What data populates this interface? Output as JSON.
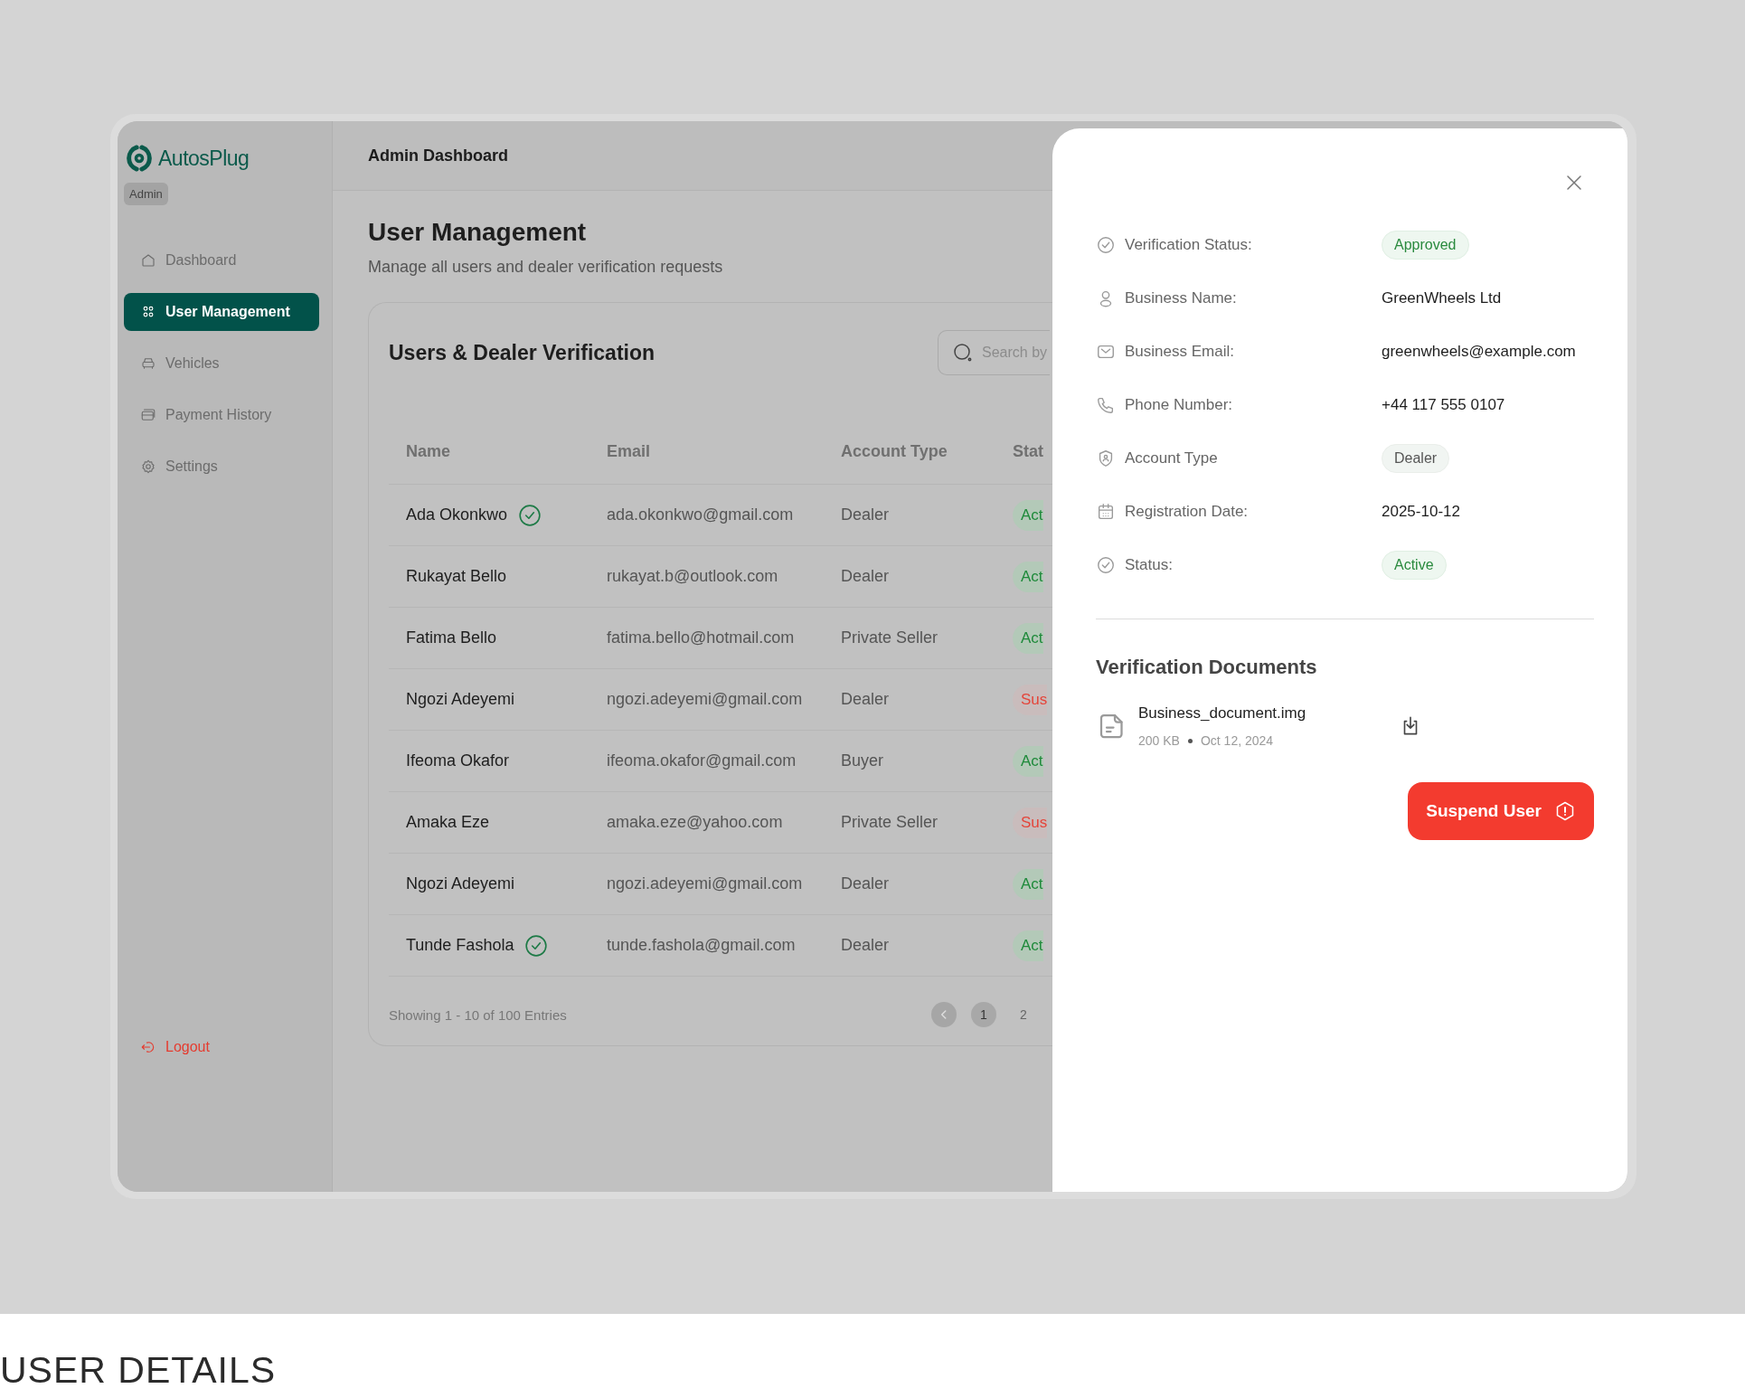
{
  "sidebar": {
    "logo": "AutosPlug",
    "role_badge": "Admin",
    "items": [
      {
        "label": "Dashboard",
        "selected": false
      },
      {
        "label": "User Management",
        "selected": true
      },
      {
        "label": "Vehicles",
        "selected": false
      },
      {
        "label": "Payment History",
        "selected": false
      },
      {
        "label": "Settings",
        "selected": false
      }
    ],
    "logout": "Logout"
  },
  "header": {
    "title": "Admin Dashboard"
  },
  "page": {
    "title": "User Management",
    "subtitle": "Manage all users and dealer verification requests"
  },
  "card": {
    "title": "Users & Dealer Verification",
    "search": {
      "placeholder": "Search by"
    },
    "columns": [
      "Name",
      "Email",
      "Account Type",
      "Stat"
    ],
    "rows": [
      {
        "name": "Ada Okonkwo",
        "verified": true,
        "email": "ada.okonkwo@gmail.com",
        "account_type": "Dealer",
        "status": "Act",
        "kind": "active"
      },
      {
        "name": "Rukayat Bello",
        "verified": false,
        "email": "rukayat.b@outlook.com",
        "account_type": "Dealer",
        "status": "Act",
        "kind": "active"
      },
      {
        "name": "Fatima Bello",
        "verified": false,
        "email": "fatima.bello@hotmail.com",
        "account_type": "Private Seller",
        "status": "Act",
        "kind": "active"
      },
      {
        "name": "Ngozi Adeyemi",
        "verified": false,
        "email": "ngozi.adeyemi@gmail.com",
        "account_type": "Dealer",
        "status": "Sus",
        "kind": "suspended"
      },
      {
        "name": "Ifeoma Okafor",
        "verified": false,
        "email": "ifeoma.okafor@gmail.com",
        "account_type": "Buyer",
        "status": "Act",
        "kind": "active"
      },
      {
        "name": "Amaka Eze",
        "verified": false,
        "email": "amaka.eze@yahoo.com",
        "account_type": "Private Seller",
        "status": "Sus",
        "kind": "suspended"
      },
      {
        "name": "Ngozi Adeyemi",
        "verified": false,
        "email": "ngozi.adeyemi@gmail.com",
        "account_type": "Dealer",
        "status": "Act",
        "kind": "active"
      },
      {
        "name": "Tunde Fashola",
        "verified": true,
        "email": "tunde.fashola@gmail.com",
        "account_type": "Dealer",
        "status": "Act",
        "kind": "active"
      }
    ],
    "footer": "Showing 1 - 10 of 100 Entries",
    "pages": [
      {
        "label": "1",
        "selected": true
      },
      {
        "label": "2",
        "selected": false
      }
    ]
  },
  "details": {
    "fields": [
      {
        "label": "Verification Status:",
        "value": "Approved",
        "kind": "success_badge"
      },
      {
        "label": "Business Name:",
        "value": "GreenWheels Ltd",
        "kind": "text"
      },
      {
        "label": "Business Email:",
        "value": "greenwheels@example.com",
        "kind": "text"
      },
      {
        "label": "Phone Number:",
        "value": "+44 117 555 0107",
        "kind": "text"
      },
      {
        "label": "Account Type",
        "value": "Dealer",
        "kind": "neutral_badge"
      },
      {
        "label": "Registration Date:",
        "value": "2025-10-12",
        "kind": "text"
      },
      {
        "label": "Status:",
        "value": "Active",
        "kind": "success_badge"
      }
    ],
    "documents_title": "Verification Documents",
    "documents": [
      {
        "name": "Business_document.img",
        "size": "200 KB",
        "date": "Oct 12, 2024"
      }
    ],
    "suspend_button": "Suspend User"
  },
  "caption": "USER DETAILS"
}
